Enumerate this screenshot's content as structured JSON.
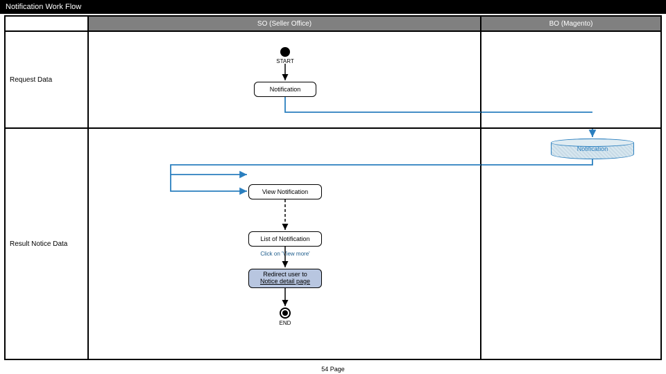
{
  "title": "Notification Work Flow",
  "headers": {
    "col2": "SO (Seller Office)",
    "col3": "BO (Magento)"
  },
  "rows": {
    "r1": "Request Data",
    "r2": "Result Notice Data"
  },
  "nodes": {
    "start": "START",
    "notification": "Notification",
    "db": "Notification",
    "view": "View Notification",
    "list": "List of Notification",
    "click": "Click on 'View more'",
    "redirect_l1": "Redirect user to",
    "redirect_l2": "Notice detail page",
    "end": "END"
  },
  "footer": "54 Page"
}
